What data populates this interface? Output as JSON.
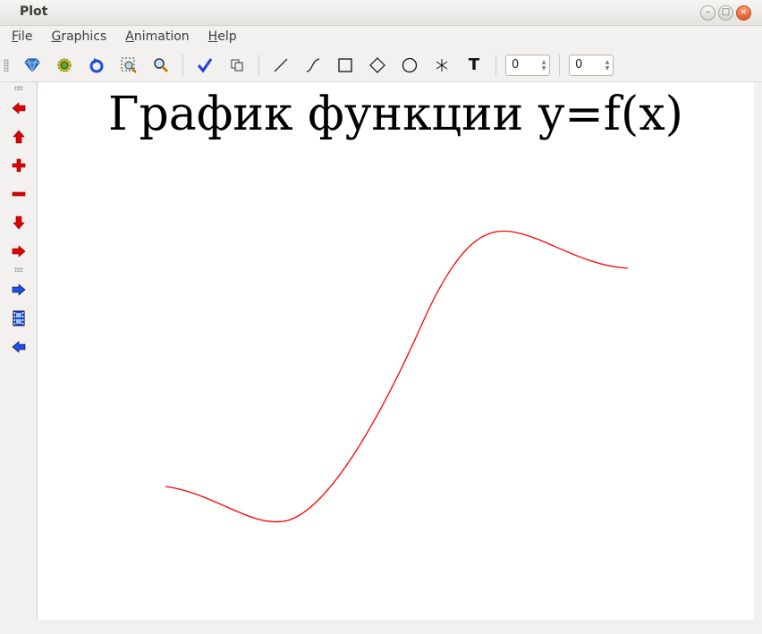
{
  "window": {
    "title": "Plot"
  },
  "menu": {
    "file": {
      "mnemonic": "F",
      "rest": "ile"
    },
    "graphics": {
      "mnemonic": "G",
      "rest": "raphics"
    },
    "animation": {
      "mnemonic": "A",
      "rest": "nimation"
    },
    "help": {
      "mnemonic": "H",
      "rest": "elp"
    }
  },
  "toolbar": {
    "icons": [
      "gem-icon",
      "gear-icon",
      "refresh-icon",
      "zoom-region-icon",
      "zoom-icon",
      "checkmark-icon",
      "copy-icon",
      "line-tool-icon",
      "curve-tool-icon",
      "rectangle-tool-icon",
      "diamond-tool-icon",
      "ellipse-tool-icon",
      "asterisk-tool-icon",
      "text-tool-icon"
    ],
    "text_tool_label": "T",
    "spin1_value": "0",
    "spin2_value": "0"
  },
  "sidebar": {
    "icons": [
      "arrow-left-icon",
      "arrow-up-icon",
      "plus-icon",
      "minus-icon",
      "arrow-down-icon",
      "arrow-right-icon",
      "play-forward-icon",
      "film-icon",
      "play-back-icon"
    ]
  },
  "plot": {
    "title": "График функции y=f(x)",
    "curve_color": "#ff0000"
  },
  "colors": {
    "toolbar_red": "#e00000",
    "toolbar_blue": "#0030e0"
  }
}
